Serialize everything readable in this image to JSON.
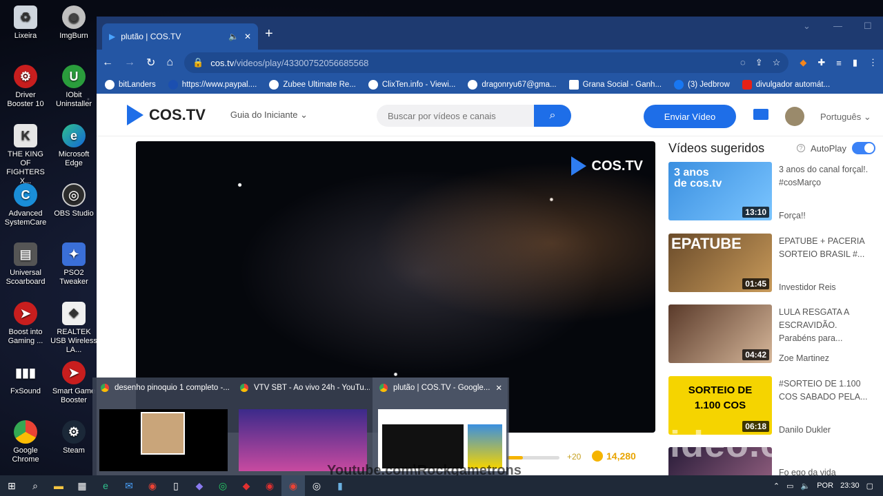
{
  "desktop_icons": [
    {
      "label": "Lixeira",
      "icon": "recycle-bin-icon"
    },
    {
      "label": "ImgBurn",
      "icon": "imgburn-icon"
    },
    {
      "label": "Driver Booster 10",
      "icon": "driver-booster-icon"
    },
    {
      "label": "IObit Uninstaller",
      "icon": "iobit-uninstaller-icon"
    },
    {
      "label": "THE KING OF FIGHTERS X...",
      "icon": "kof-icon"
    },
    {
      "label": "Microsoft Edge",
      "icon": "edge-icon"
    },
    {
      "label": "Advanced SystemCare",
      "icon": "advanced-systemcare-icon"
    },
    {
      "label": "OBS Studio",
      "icon": "obs-icon"
    },
    {
      "label": "Universal Scoarboard",
      "icon": "scoreboard-icon"
    },
    {
      "label": "PSO2 Tweaker",
      "icon": "pso2-tweaker-icon"
    },
    {
      "label": "Boost into Gaming ...",
      "icon": "boost-gaming-icon"
    },
    {
      "label": "REALTEK USB Wireless LA...",
      "icon": "realtek-icon"
    },
    {
      "label": "FxSound",
      "icon": "fxsound-icon"
    },
    {
      "label": "Smart Game Booster",
      "icon": "smart-game-booster-icon"
    },
    {
      "label": "Google Chrome",
      "icon": "chrome-icon"
    },
    {
      "label": "Steam",
      "icon": "steam-icon"
    }
  ],
  "browser": {
    "tab_title": "plutão | COS.TV",
    "new_tab": "+",
    "url_main": "cos.tv",
    "url_path": "/videos/play/43300752056685568",
    "bookmarks": [
      "bitLanders",
      "https://www.paypal....",
      "Zubee Ultimate Re...",
      "ClixTen.info - Viewi...",
      "dragonryu67@gma...",
      "Grana Social - Ganh...",
      "(3) Jedbrow",
      "divulgador automát..."
    ]
  },
  "site": {
    "logo": "COS.TV",
    "guide": "Guia do Iniciante ⌄",
    "search_placeholder": "Buscar por vídeos e canais",
    "send_button": "Enviar Vídeo",
    "language": "Português ⌄"
  },
  "player": {
    "logo": "COS.TV",
    "plus": "+20",
    "coins": "14,280",
    "progress": 0.3
  },
  "suggest": {
    "title": "Vídeos sugeridos",
    "autoplay": "AutoPlay",
    "videos": [
      {
        "thumb_text": "3 anos de cos.tv",
        "duration": "13:10",
        "title": "3 anos do canal forçal!. #cosMarço",
        "channel": "Força!!"
      },
      {
        "thumb_text": "EPATUBE",
        "duration": "01:45",
        "title": "EPATUBE + PACERIA SORTEIO BRASIL #...",
        "channel": "Investidor Reis"
      },
      {
        "thumb_text": "",
        "duration": "04:42",
        "title": "LULA RESGATA A ESCRAVIDÃO. Parabéns para...",
        "channel": "Zoe Martinez"
      },
      {
        "thumb_text": "SORTEIO DE 1.100 COS",
        "duration": "06:18",
        "title": "#SORTEIO DE 1.100 COS SABADO PELA...",
        "channel": "Danilo Dukler"
      },
      {
        "thumb_text": "",
        "duration": "",
        "title": "",
        "channel": "Fo ego da vida"
      }
    ]
  },
  "previews": [
    {
      "title": "desenho pinoquio 1 completo -..."
    },
    {
      "title": "VTV SBT - Ao vivo 24h - YouTu..."
    },
    {
      "title": "plutão | COS.TV - Google..."
    }
  ],
  "watermarks": {
    "clideo": "clideo.com",
    "youtube": "Youtube.com\\Rockgametrons"
  },
  "taskbar": {
    "language": "POR",
    "time": "23:30"
  }
}
